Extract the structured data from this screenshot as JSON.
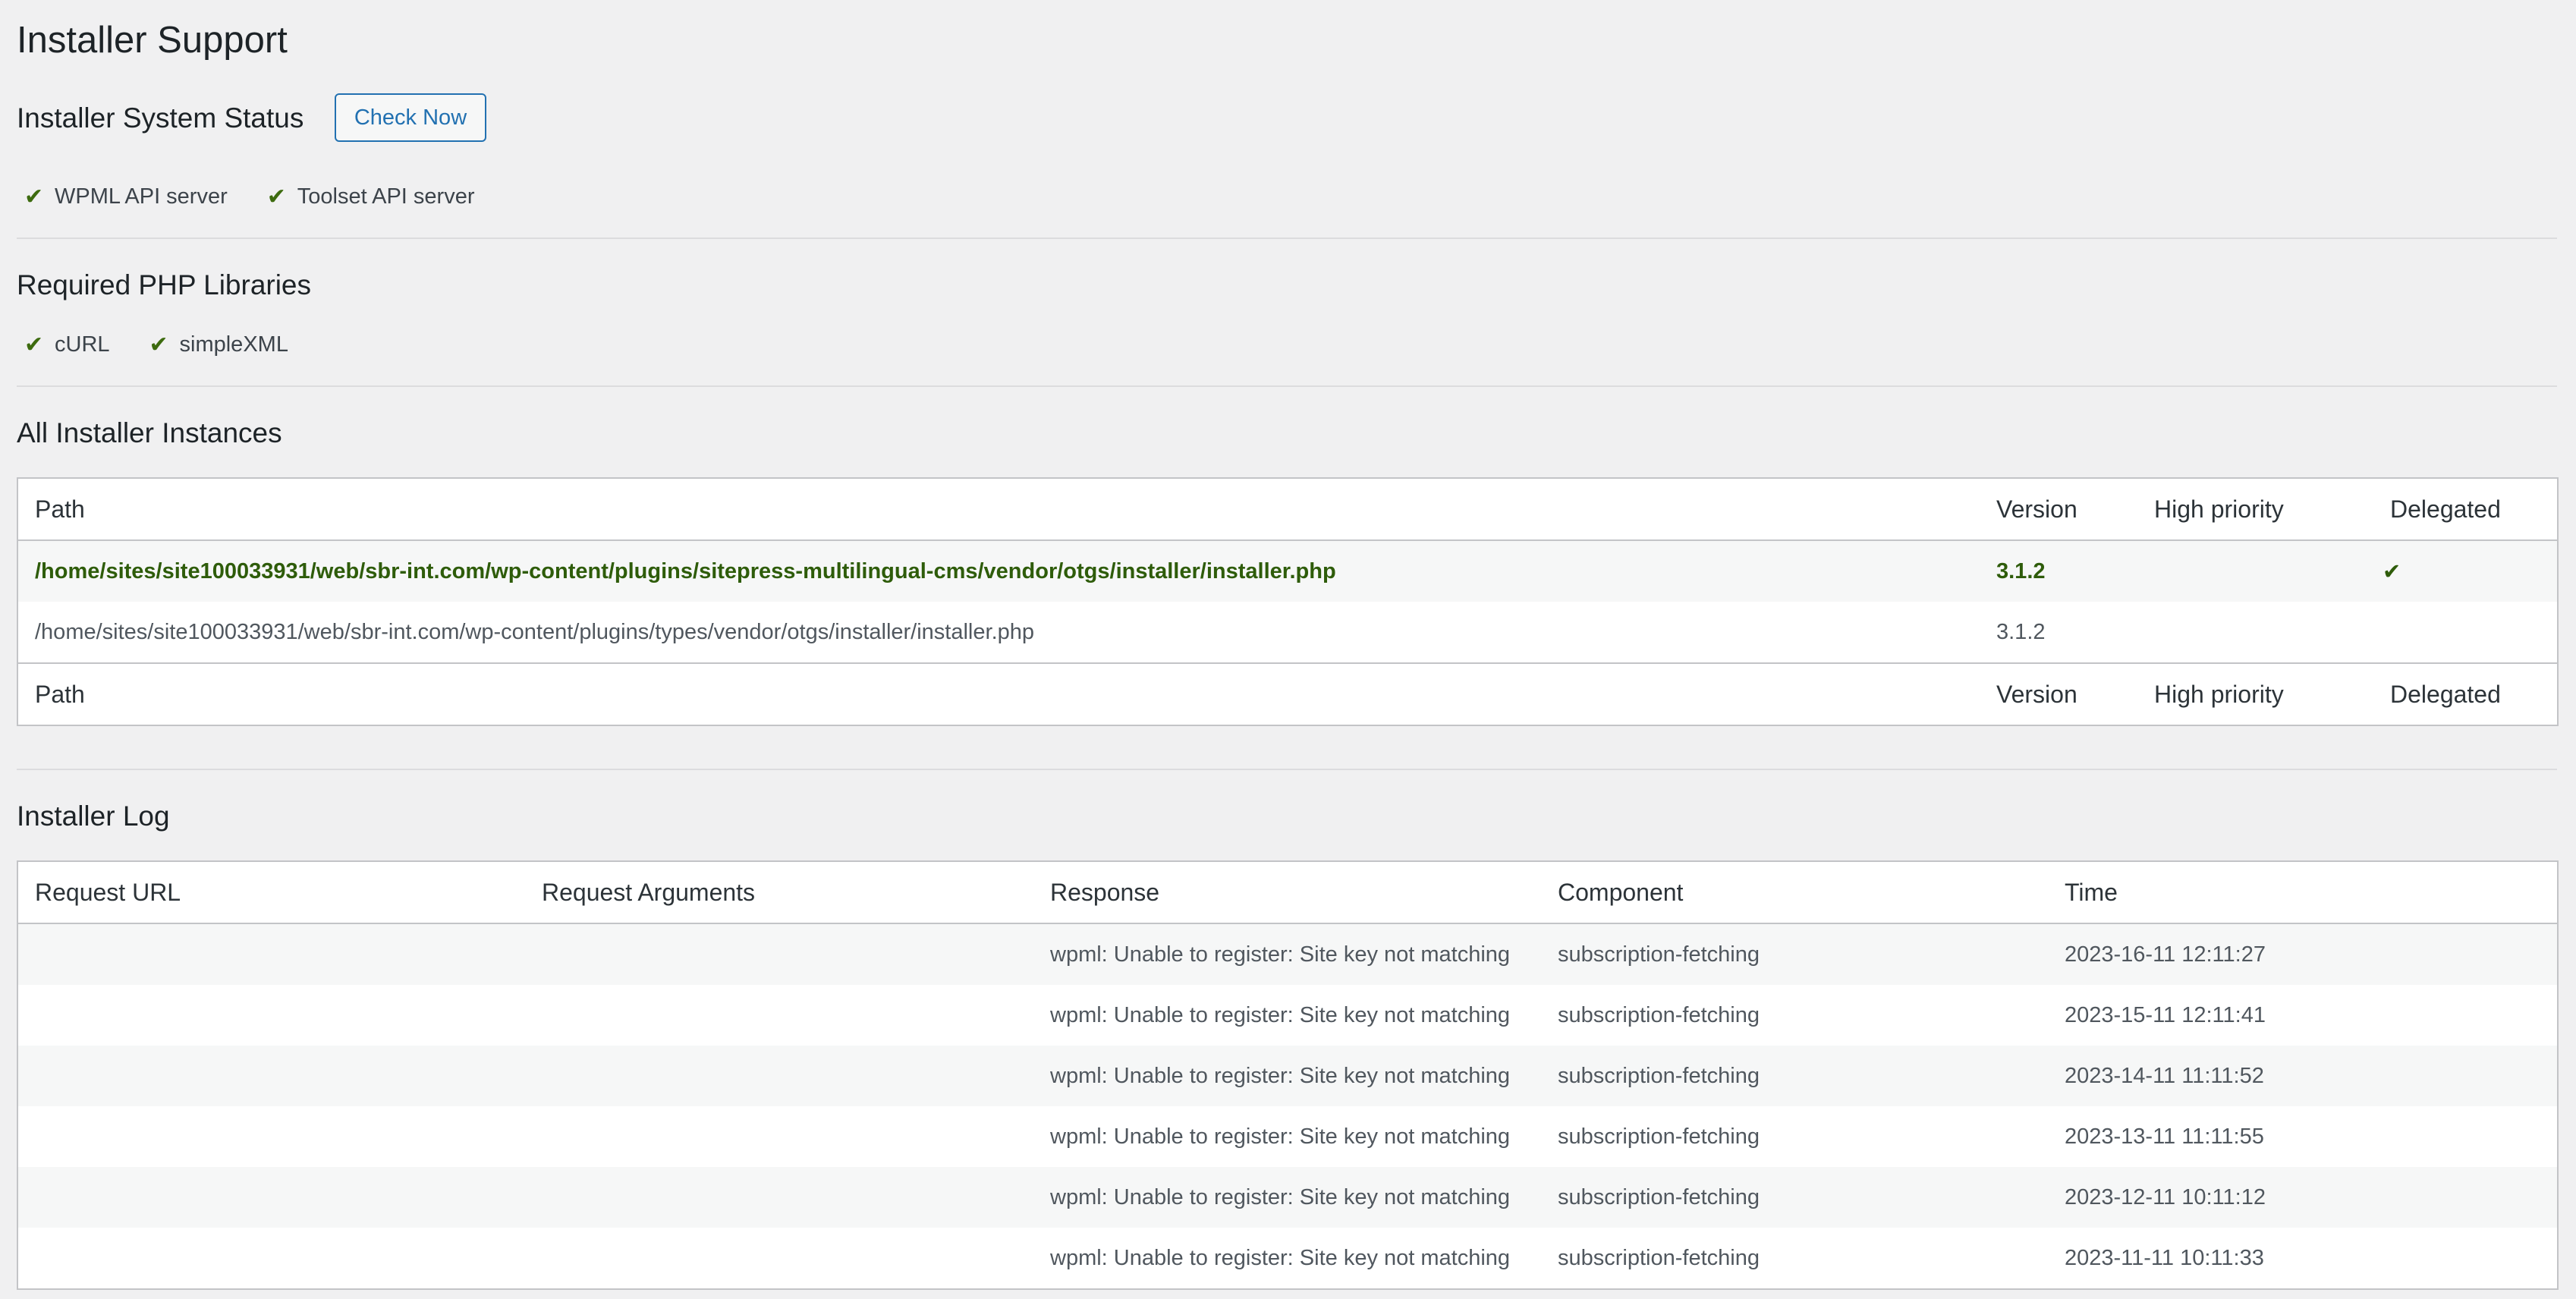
{
  "page_title": "Installer Support",
  "system_status": {
    "heading": "Installer System Status",
    "check_button": "Check Now",
    "items": [
      {
        "label": "WPML API server",
        "ok": true,
        "icon": "check-icon"
      },
      {
        "label": "Toolset API server",
        "ok": true,
        "icon": "check-icon"
      }
    ]
  },
  "php_libraries": {
    "heading": "Required PHP Libraries",
    "items": [
      {
        "label": "cURL",
        "ok": true,
        "icon": "check-icon"
      },
      {
        "label": "simpleXML",
        "ok": true,
        "icon": "check-icon"
      }
    ]
  },
  "instances": {
    "heading": "All Installer Instances",
    "columns": {
      "path": "Path",
      "version": "Version",
      "high_priority": "High priority",
      "delegated": "Delegated"
    },
    "rows": [
      {
        "path": "/home/sites/site100033931/web/sbr-int.com/wp-content/plugins/sitepress-multilingual-cms/vendor/otgs/installer/installer.php",
        "version": "3.1.2",
        "high_priority": "",
        "delegated": "✔",
        "active": true
      },
      {
        "path": "/home/sites/site100033931/web/sbr-int.com/wp-content/plugins/types/vendor/otgs/installer/installer.php",
        "version": "3.1.2",
        "high_priority": "",
        "delegated": "",
        "active": false
      }
    ]
  },
  "log": {
    "heading": "Installer Log",
    "columns": {
      "request_url": "Request URL",
      "request_arguments": "Request Arguments",
      "response": "Response",
      "component": "Component",
      "time": "Time"
    },
    "rows": [
      {
        "request_url": "",
        "request_arguments": "",
        "response": "wpml: Unable to register: Site key not matching",
        "component": "subscription-fetching",
        "time": "2023-16-11 12:11:27"
      },
      {
        "request_url": "",
        "request_arguments": "",
        "response": "wpml: Unable to register: Site key not matching",
        "component": "subscription-fetching",
        "time": "2023-15-11 12:11:41"
      },
      {
        "request_url": "",
        "request_arguments": "",
        "response": "wpml: Unable to register: Site key not matching",
        "component": "subscription-fetching",
        "time": "2023-14-11 11:11:52"
      },
      {
        "request_url": "",
        "request_arguments": "",
        "response": "wpml: Unable to register: Site key not matching",
        "component": "subscription-fetching",
        "time": "2023-13-11 11:11:55"
      },
      {
        "request_url": "",
        "request_arguments": "",
        "response": "wpml: Unable to register: Site key not matching",
        "component": "subscription-fetching",
        "time": "2023-12-11 10:11:12"
      },
      {
        "request_url": "",
        "request_arguments": "",
        "response": "wpml: Unable to register: Site key not matching",
        "component": "subscription-fetching",
        "time": "2023-11-11 10:11:33"
      }
    ]
  }
}
